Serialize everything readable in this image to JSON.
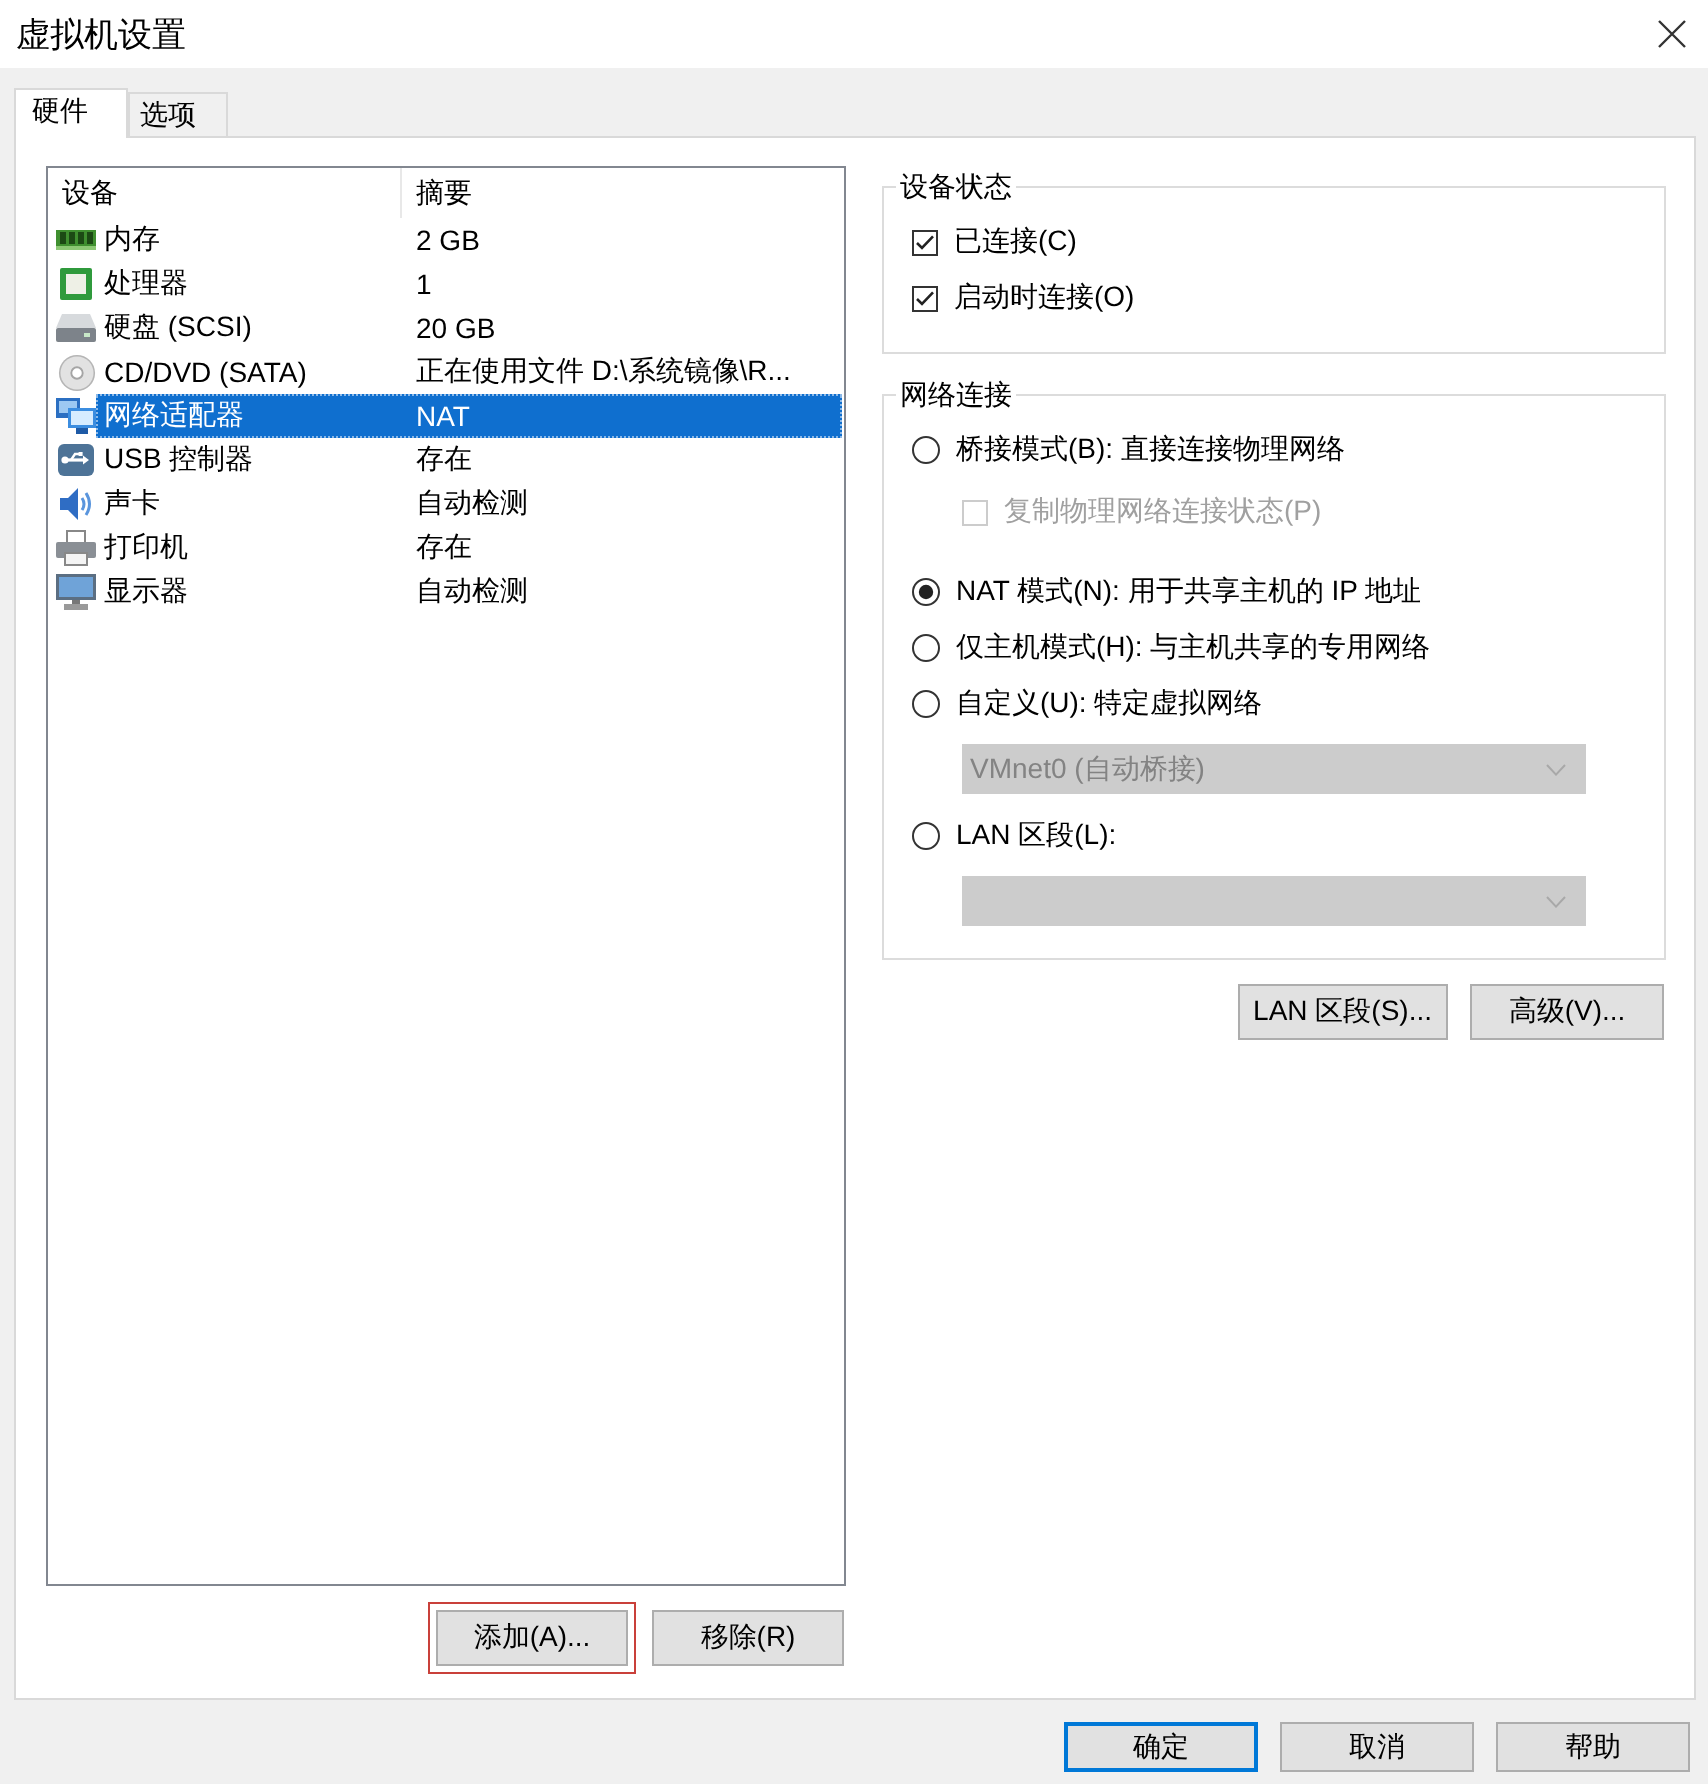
{
  "window": {
    "title": "虚拟机设置"
  },
  "tabs": [
    {
      "label": "硬件",
      "selected": true
    },
    {
      "label": "选项",
      "selected": false
    }
  ],
  "device_list": {
    "columns": [
      "设备",
      "摘要"
    ],
    "rows": [
      {
        "kind": "memory",
        "device": "内存",
        "summary": "2 GB",
        "selected": false
      },
      {
        "kind": "processor",
        "device": "处理器",
        "summary": "1",
        "selected": false
      },
      {
        "kind": "hard_disk",
        "device": "硬盘 (SCSI)",
        "summary": "20 GB",
        "selected": false
      },
      {
        "kind": "cd_dvd",
        "device": "CD/DVD (SATA)",
        "summary": "正在使用文件 D:\\系统镜像\\R...",
        "selected": false
      },
      {
        "kind": "network",
        "device": "网络适配器",
        "summary": "NAT",
        "selected": true
      },
      {
        "kind": "usb",
        "device": "USB 控制器",
        "summary": "存在",
        "selected": false
      },
      {
        "kind": "sound",
        "device": "声卡",
        "summary": "自动检测",
        "selected": false
      },
      {
        "kind": "printer",
        "device": "打印机",
        "summary": "存在",
        "selected": false
      },
      {
        "kind": "display",
        "device": "显示器",
        "summary": "自动检测",
        "selected": false
      }
    ]
  },
  "list_buttons": [
    {
      "label": "添加(A)...",
      "highlighted": true
    },
    {
      "label": "移除(R)",
      "highlighted": false
    }
  ],
  "device_status": {
    "title": "设备状态",
    "options": [
      {
        "label": "已连接(C)",
        "checked": true
      },
      {
        "label": "启动时连接(O)",
        "checked": true
      }
    ]
  },
  "network_connection": {
    "title": "网络连接",
    "items": [
      {
        "kind": "radio",
        "label": "桥接模式(B): 直接连接物理网络",
        "selected": false,
        "disabled": false
      },
      {
        "kind": "checkbox",
        "label": "复制物理网络连接状态(P)",
        "checked": false,
        "disabled": true
      },
      {
        "kind": "radio",
        "label": "NAT 模式(N): 用于共享主机的 IP 地址",
        "selected": true,
        "disabled": false
      },
      {
        "kind": "radio",
        "label": "仅主机模式(H): 与主机共享的专用网络",
        "selected": false,
        "disabled": false
      },
      {
        "kind": "radio",
        "label": "自定义(U): 特定虚拟网络",
        "selected": false,
        "disabled": false
      },
      {
        "kind": "dropdown",
        "value": "VMnet0 (自动桥接)",
        "disabled": true
      },
      {
        "kind": "radio",
        "label": "LAN 区段(L):",
        "selected": false,
        "disabled": false
      },
      {
        "kind": "dropdown",
        "disabled": true
      }
    ]
  },
  "network_buttons": [
    {
      "label": "LAN 区段(S)..."
    },
    {
      "label": "高级(V)..."
    }
  ],
  "dialog_buttons": [
    {
      "label": "确定",
      "default": true
    },
    {
      "label": "取消",
      "default": false
    },
    {
      "label": "帮助",
      "default": false
    }
  ]
}
